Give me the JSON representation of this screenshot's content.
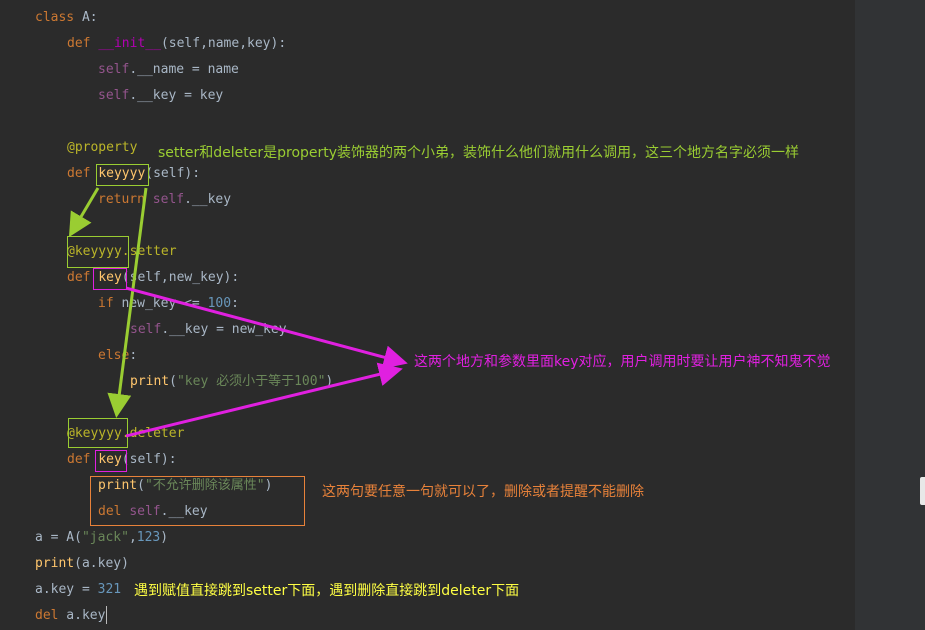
{
  "code": {
    "line1": {
      "kw": "class",
      "name": " A:"
    },
    "line2": {
      "kw": "def",
      "fn": "__init__",
      "rest": "(self,name,key):"
    },
    "line3": {
      "self": "self",
      "rest": ".__name = name"
    },
    "line4": {
      "self": "self",
      "rest": ".__key = key"
    },
    "line6": {
      "deco": "@property"
    },
    "line7": {
      "kw": "def",
      "fn": "keyyyy",
      "rest": "(self):"
    },
    "line8": {
      "kw": "return",
      "self": "self",
      "rest": ".__key"
    },
    "line10": {
      "deco": "@keyyyy.setter"
    },
    "line11": {
      "kw": "def",
      "fn": "key",
      "rest": "(self,new_key):"
    },
    "line12": {
      "kw": "if",
      "rest": " new_key <= ",
      "num": "100",
      "tail": ":"
    },
    "line13": {
      "self": "self",
      "rest": ".__key = new_key"
    },
    "line14": {
      "kw": "else",
      "rest": ":"
    },
    "line15": {
      "fn": "print",
      "open": "(",
      "str": "\"key 必须小于等于100\"",
      "close": ")"
    },
    "line17": {
      "deco": "@keyyyy.deleter"
    },
    "line18": {
      "kw": "def",
      "fn": "key",
      "rest": "(self):"
    },
    "line19": {
      "fn": "print",
      "open": "(",
      "str": "\"不允许删除该属性\"",
      "close": ")"
    },
    "line20": {
      "kw": "del",
      "self": "self",
      "rest": ".__key"
    },
    "line21": {
      "rest": "a = A(",
      "str": "\"jack\"",
      "comma": ",",
      "num": "123",
      "close": ")"
    },
    "line22": {
      "fn": "print",
      "rest": "(a.key)"
    },
    "line23": {
      "rest": "a.key = ",
      "num": "321"
    },
    "line24": {
      "kw": "del",
      "rest": " a.key"
    }
  },
  "annotations": {
    "property_note": "setter和deleter是property装饰器的两个小弟，装饰什么他们就用什么调用，这三个地方名字必须一样",
    "key_note": "这两个地方和参数里面key对应，用户调用时要让用户神不知鬼不觉",
    "either_note": "这两句要任意一句就可以了，删除或者提醒不能删除",
    "jump_note": "遇到赋值直接跳到setter下面，遇到删除直接跳到deleter下面"
  },
  "colors": {
    "background": "#2b2b2b",
    "keyword": "#cc7832",
    "function": "#ffc66d",
    "string": "#6a8759",
    "number": "#6897bb",
    "decorator": "#bbb529",
    "annotation_green": "#9acd32",
    "annotation_magenta": "#e020e0",
    "annotation_orange": "#e8823a",
    "annotation_yellow": "#ffff44"
  }
}
